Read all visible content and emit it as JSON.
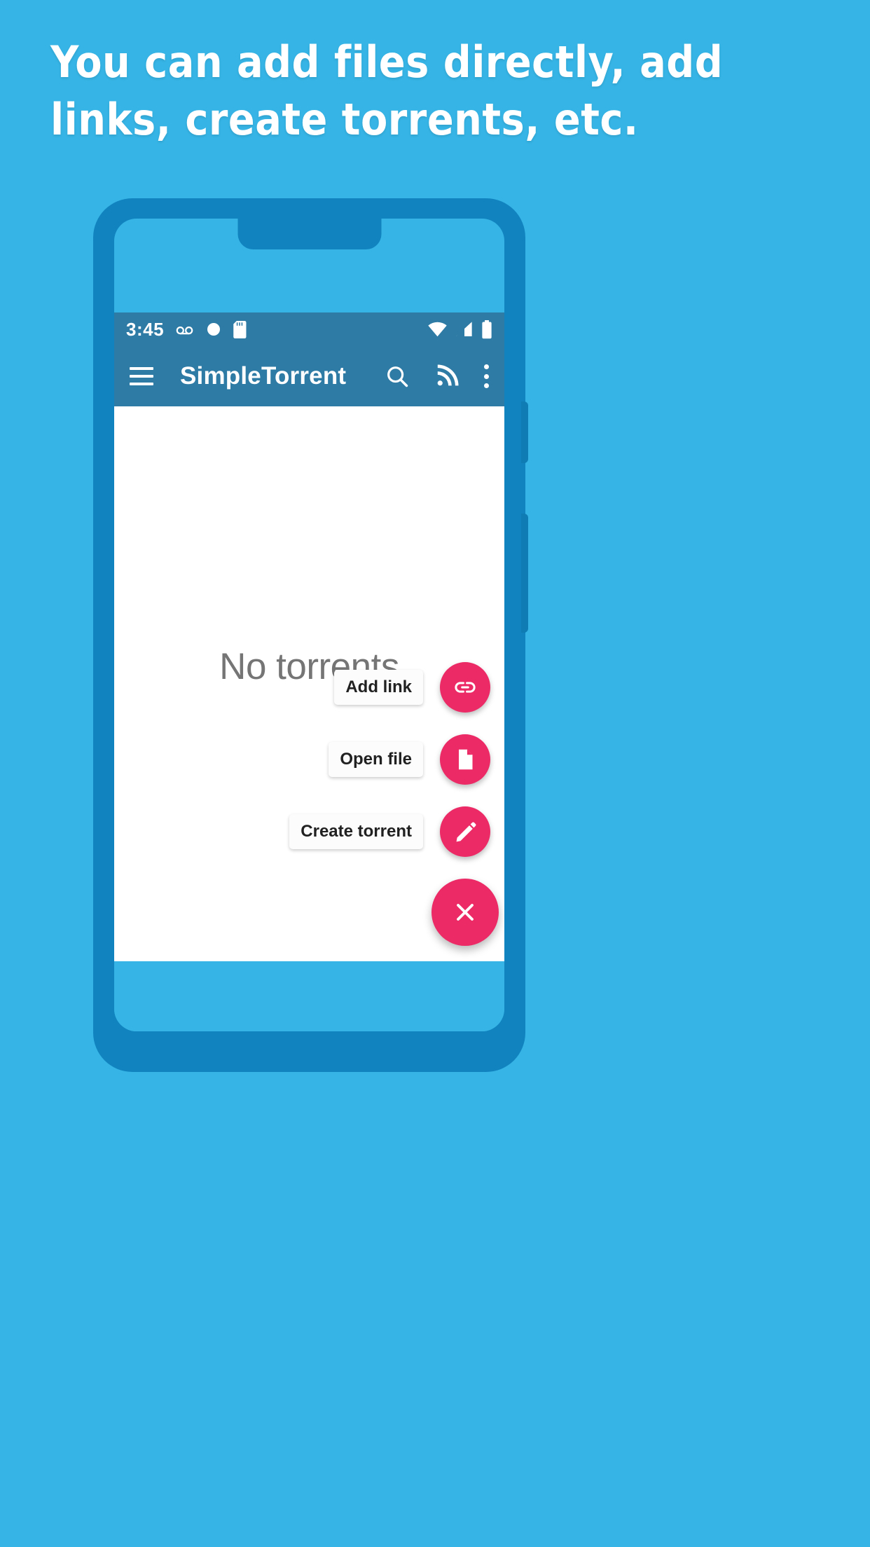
{
  "promo": {
    "headline_line1": "You can add files directly, add",
    "headline_line2": "links, create torrents, etc.",
    "background_color": "#36b4e5",
    "text_color": "#ffffff"
  },
  "device": {
    "frame_color": "#1184c0",
    "screen_background": "#36b4e5"
  },
  "status_bar": {
    "time": "3:45",
    "background_color": "#2e7ba5",
    "left_icons": [
      "voicemail-icon",
      "circle-icon",
      "sd-card-icon"
    ],
    "right_icons": [
      "wifi-icon",
      "cell-signal-icon",
      "battery-icon"
    ]
  },
  "app_bar": {
    "title": "SimpleTorrent",
    "background_color": "#2e7ba5",
    "menu_icon": "hamburger-menu-icon",
    "actions": [
      {
        "name": "search-icon",
        "label": "Search"
      },
      {
        "name": "rss-feed-icon",
        "label": "RSS feed"
      },
      {
        "name": "overflow-menu-icon",
        "label": "More options"
      }
    ]
  },
  "content": {
    "empty_state_text": "No torrents",
    "empty_state_color": "#757575",
    "background_color": "#ffffff"
  },
  "speed_dial": {
    "accent_color": "#ec2a66",
    "expanded": true,
    "actions": [
      {
        "label": "Add link",
        "icon": "link-icon"
      },
      {
        "label": "Open file",
        "icon": "file-document-icon"
      },
      {
        "label": "Create torrent",
        "icon": "pencil-icon"
      }
    ],
    "main_button": {
      "icon": "close-icon",
      "label": "Close menu"
    }
  }
}
